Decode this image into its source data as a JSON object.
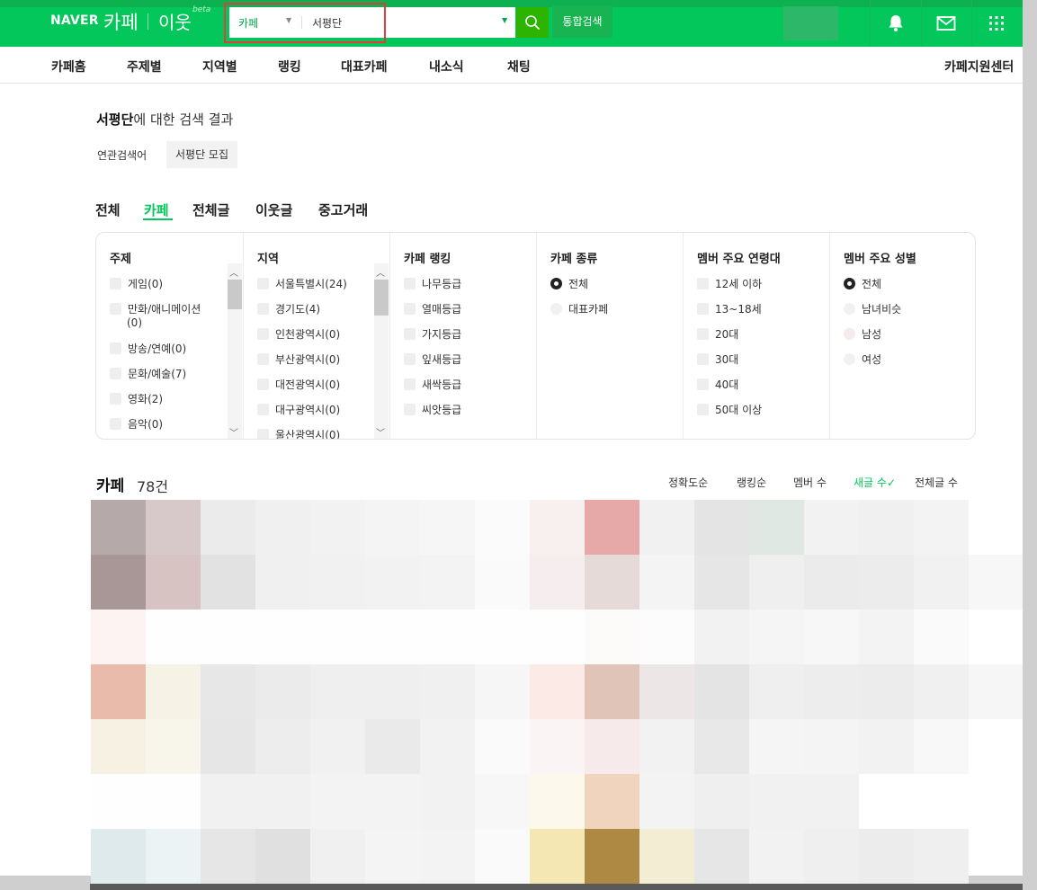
{
  "header": {
    "naver_logo": "NAVER",
    "cafe_logo": "카페",
    "neighbor_logo": "이웃",
    "beta_badge": "beta",
    "search_scope": "카페",
    "search_value": "서평단",
    "unified_search_label": "통합검색",
    "icons": [
      "search-icon",
      "bell-icon",
      "mail-icon",
      "apps-grid-icon"
    ]
  },
  "lnb": {
    "items": [
      "카페홈",
      "주제별",
      "지역별",
      "랭킹",
      "대표카페",
      "내소식",
      "채팅"
    ],
    "support": "카페지원센터"
  },
  "results": {
    "keyword": "서평단",
    "title_suffix": "에 대한 검색 결과",
    "related_label": "연관검색어",
    "related_keyword": "서평단 모집"
  },
  "tabs": [
    {
      "label": "전체",
      "active": false
    },
    {
      "label": "카페",
      "active": true
    },
    {
      "label": "전체글",
      "active": false
    },
    {
      "label": "이웃글",
      "active": false
    },
    {
      "label": "중고거래",
      "active": false
    }
  ],
  "filters": {
    "topic": {
      "title": "주제",
      "options": [
        "게임(0)",
        "만화/애니메이션",
        "(0)",
        "방송/연예(0)",
        "문화/예술(7)",
        "영화(2)",
        "음악(0)"
      ]
    },
    "region": {
      "title": "지역",
      "options": [
        "서울특별시(24)",
        "경기도(4)",
        "인천광역시(0)",
        "부산광역시(0)",
        "대전광역시(0)",
        "대구광역시(0)",
        "울산광역시(0)"
      ]
    },
    "ranking": {
      "title": "카페 랭킹",
      "options": [
        "나무등급",
        "열매등급",
        "가지등급",
        "잎새등급",
        "새싹등급",
        "씨앗등급"
      ]
    },
    "type": {
      "title": "카페 종류",
      "options": [
        "전체",
        "대표카페"
      ],
      "selected": "전체"
    },
    "age": {
      "title": "멤버 주요 연령대",
      "options": [
        "12세 이하",
        "13~18세",
        "20대",
        "30대",
        "40대",
        "50대 이상"
      ]
    },
    "gender": {
      "title": "멤버 주요 성별",
      "options": [
        "전체",
        "남녀비슷",
        "남성",
        "여성"
      ],
      "selected": "전체"
    }
  },
  "cafe_list": {
    "title": "카페",
    "count": "78건",
    "sort_options": [
      "정확도순",
      "랭킹순",
      "멤버 수",
      "새글 수",
      "전체글 수"
    ],
    "active_sort": "새글 수",
    "active_check": "✓"
  },
  "colors": {
    "brand_green": "#03c75a",
    "highlight_red": "#e23c3c"
  }
}
